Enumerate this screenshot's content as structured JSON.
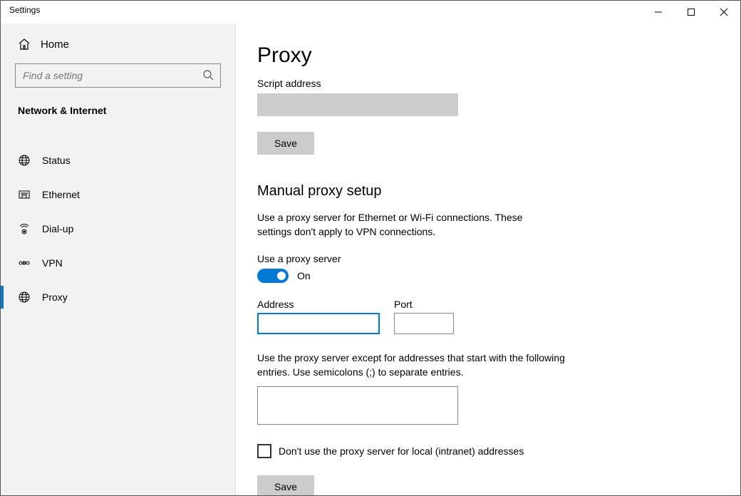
{
  "window": {
    "title": "Settings"
  },
  "sidebar": {
    "home": "Home",
    "search_placeholder": "Find a setting",
    "category": "Network & Internet",
    "items": [
      {
        "label": "Status"
      },
      {
        "label": "Ethernet"
      },
      {
        "label": "Dial-up"
      },
      {
        "label": "VPN"
      },
      {
        "label": "Proxy"
      }
    ]
  },
  "page": {
    "title": "Proxy",
    "script_address_label": "Script address",
    "script_address_value": "",
    "save_label": "Save",
    "manual_title": "Manual proxy setup",
    "manual_desc": "Use a proxy server for Ethernet or Wi-Fi connections. These settings don't apply to VPN connections.",
    "use_proxy_label": "Use a proxy server",
    "toggle_state": "On",
    "address_label": "Address",
    "address_value": "",
    "port_label": "Port",
    "port_value": "",
    "exceptions_desc": "Use the proxy server except for addresses that start with the following entries. Use semicolons (;) to separate entries.",
    "exceptions_value": "",
    "bypass_local_label": "Don't use the proxy server for local (intranet) addresses"
  }
}
